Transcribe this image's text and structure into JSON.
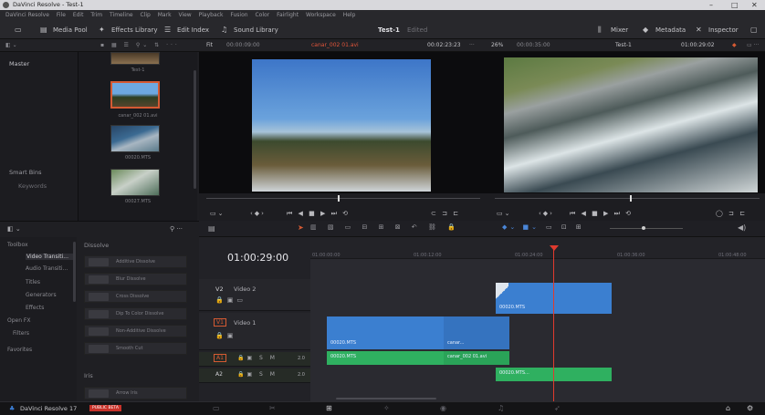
{
  "window": {
    "title": "DaVinci Resolve - Test-1",
    "controls": [
      "–",
      "□",
      "✕"
    ]
  },
  "menu": [
    "DaVinci Resolve",
    "File",
    "Edit",
    "Trim",
    "Timeline",
    "Clip",
    "Mark",
    "View",
    "Playback",
    "Fusion",
    "Color",
    "Fairlight",
    "Workspace",
    "Help"
  ],
  "toolbar": {
    "media_pool": "Media Pool",
    "effects_library": "Effects Library",
    "edit_index": "Edit Index",
    "sound_library": "Sound Library",
    "project": "Test-1",
    "project_status": "Edited",
    "mixer": "Mixer",
    "metadata": "Metadata",
    "inspector": "Inspector"
  },
  "source_bar": {
    "fit": "Fit",
    "tc_left": "00:00:09:00",
    "clip": "canar_002 01.avi",
    "tc_right": "00:02:23:23"
  },
  "program_bar": {
    "zoom": "26%",
    "tc_left": "00:00:35:00",
    "timeline": "Test-1",
    "tc_right": "01:00:29:02"
  },
  "bins": {
    "master": "Master",
    "smart_bins": "Smart Bins",
    "keywords": "Keywords"
  },
  "clips": [
    {
      "label": "Test-1"
    },
    {
      "label": "canar_002 01.avi"
    },
    {
      "label": "00020.MTS"
    },
    {
      "label": "00027.MTS"
    }
  ],
  "effects": {
    "categories": [
      "Toolbox",
      "Video Transiti...",
      "Audio Transiti...",
      "Titles",
      "Generators",
      "Effects",
      "Open FX",
      "Filters",
      "Favorites"
    ],
    "section": "Dissolve",
    "items": [
      "Additive Dissolve",
      "Blur Dissolve",
      "Cross Dissolve",
      "Dip To Color Dissolve",
      "Non-Additive Dissolve",
      "Smooth Cut"
    ],
    "section2": "Iris",
    "item_iris": "Arrow Iris"
  },
  "timeline": {
    "timecode": "01:00:29:00",
    "ticks": [
      "01:00:00:00",
      "01:00:12:00",
      "01:00:24:00",
      "01:00:36:00",
      "01:00:48:00"
    ],
    "tracks": {
      "v2": "V2",
      "v2_name": "Video 2",
      "v1": "V1",
      "v1_name": "Video 1",
      "a1": "A1",
      "a2": "A2",
      "a_level": "2.0"
    },
    "clips": {
      "v2": "00020.MTS",
      "v1a": "00020.MTS",
      "v1b": "canar...",
      "a1a": "00020.MTS",
      "a1b": "canar_002 01.avi",
      "a2": "00020.MTS..."
    }
  },
  "status": {
    "app": "DaVinci Resolve 17",
    "badge": "PUBLIC BETA"
  }
}
